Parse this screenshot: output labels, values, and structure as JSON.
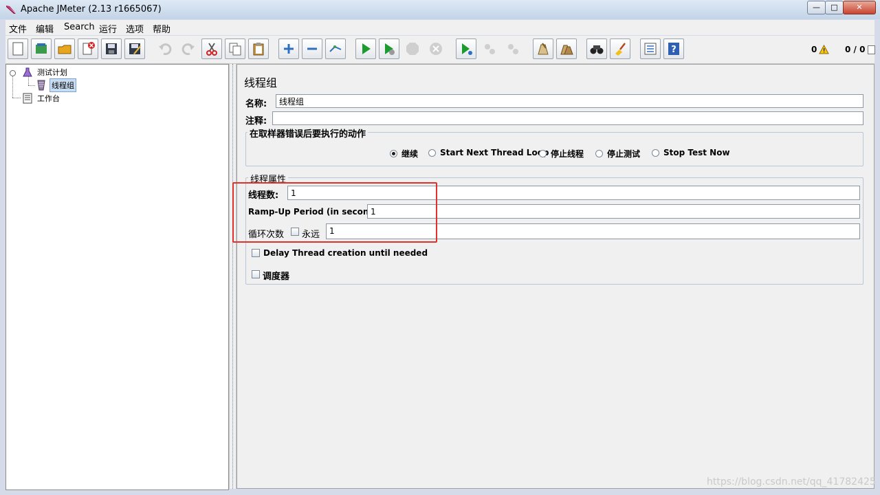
{
  "window": {
    "title": "Apache JMeter (2.13 r1665067)"
  },
  "window_controls": {
    "minimize": "—",
    "maximize": "□",
    "close": "✕"
  },
  "menu": [
    "文件",
    "编辑",
    "Search",
    "运行",
    "选项",
    "帮助"
  ],
  "toolbar": {
    "icons": [
      "new-icon",
      "templates-icon",
      "open-icon",
      "close-file-icon",
      "save-icon",
      "save-as-icon",
      "undo-icon",
      "redo-icon",
      "cut-icon",
      "copy-icon",
      "paste-icon",
      "expand-icon",
      "collapse-icon",
      "toggle-icon",
      "start-icon",
      "start-no-pause-icon",
      "stop-icon",
      "shutdown-icon",
      "remote-start-icon",
      "remote-stop-icon",
      "remote-shutdown-icon",
      "clear-icon",
      "clear-all-icon",
      "search-icon",
      "reset-search-icon",
      "function-helper-icon",
      "help-icon"
    ],
    "error_count": "0",
    "thread_count": "0 / 0"
  },
  "tree": {
    "test_plan": "测试计划",
    "thread_group": "线程组",
    "workbench": "工作台"
  },
  "panel": {
    "title": "线程组",
    "name_label": "名称:",
    "name_value": "线程组",
    "comment_label": "注释:",
    "comment_value": ""
  },
  "on_error": {
    "title": "在取样器错误后要执行的动作",
    "options": [
      "继续",
      "Start Next Thread Loop",
      "停止线程",
      "停止测试",
      "Stop Test Now"
    ],
    "selected": "继续"
  },
  "thread_props": {
    "title": "线程属性",
    "threads_label": "线程数:",
    "threads_value": "1",
    "rampup_label": "Ramp-Up Period (in seconds):",
    "rampup_value": "1",
    "loop_label": "循环次数",
    "forever_label": "永远",
    "loop_value": "1",
    "delay_label": "Delay Thread creation until needed",
    "scheduler_label": "调度器"
  },
  "watermark": "https://blog.csdn.net/qq_41782425",
  "colors": {
    "accent_red": "#e0302a",
    "selection": "#c8dcf2",
    "titlebar": "#c3d4e7"
  }
}
